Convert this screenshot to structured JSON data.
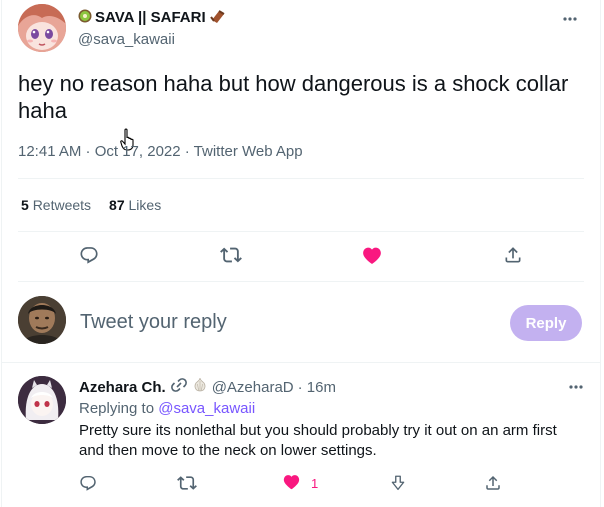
{
  "tweet": {
    "display_name": "SAVA || SAFARI",
    "handle": "@sava_kawaii",
    "text": "hey no reason haha but how dangerous is a shock collar haha",
    "meta": "12:41 AM · Oct 17, 2022 · Twitter Web App",
    "stats": {
      "retweets_count": "5",
      "retweets_label": "Retweets",
      "likes_count": "87",
      "likes_label": "Likes"
    }
  },
  "composer": {
    "placeholder": "Tweet your reply",
    "button_label": "Reply"
  },
  "reply": {
    "display_name": "Azehara Ch.",
    "handle": "@AzeharaD",
    "time": "· 16m",
    "replying_prefix": "Replying to ",
    "replying_mention": "@sava_kawaii",
    "text": "Pretty sure its nonlethal but you should probably try it out on an arm first and then move to the neck on lower settings.",
    "like_count": "1"
  },
  "colors": {
    "accent": "#7856ff",
    "like": "#f91880",
    "reply_button": "#c3b1f0",
    "secondary_text": "#536471"
  },
  "icons": {
    "reply": "reply-icon",
    "retweet": "retweet-icon",
    "like": "heart-filled-icon",
    "share": "share-icon",
    "more": "more-icon"
  }
}
